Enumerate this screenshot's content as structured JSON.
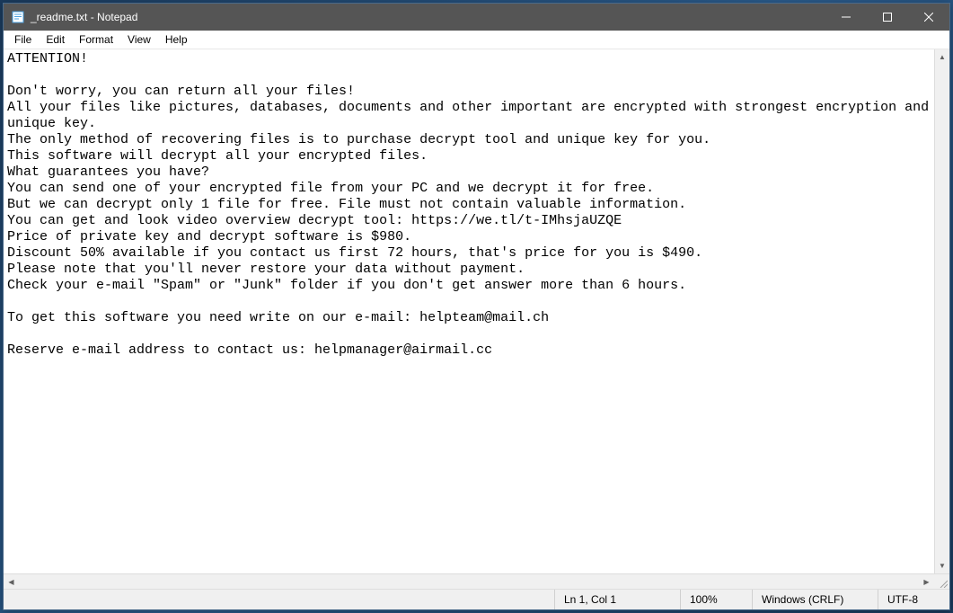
{
  "window": {
    "title": "_readme.txt - Notepad"
  },
  "menu": {
    "file": "File",
    "edit": "Edit",
    "format": "Format",
    "view": "View",
    "help": "Help"
  },
  "document": {
    "lines": [
      "ATTENTION!",
      "",
      "Don't worry, you can return all your files!",
      "All your files like pictures, databases, documents and other important are encrypted with strongest encryption and unique key.",
      "The only method of recovering files is to purchase decrypt tool and unique key for you.",
      "This software will decrypt all your encrypted files.",
      "What guarantees you have?",
      "You can send one of your encrypted file from your PC and we decrypt it for free.",
      "But we can decrypt only 1 file for free. File must not contain valuable information.",
      "You can get and look video overview decrypt tool: https://we.tl/t-IMhsjaUZQE",
      "Price of private key and decrypt software is $980.",
      "Discount 50% available if you contact us first 72 hours, that's price for you is $490.",
      "Please note that you'll never restore your data without payment.",
      "Check your e-mail \"Spam\" or \"Junk\" folder if you don't get answer more than 6 hours.",
      "",
      "To get this software you need write on our e-mail: helpteam@mail.ch",
      "",
      "Reserve e-mail address to contact us: helpmanager@airmail.cc"
    ]
  },
  "status": {
    "position": "Ln 1, Col 1",
    "zoom": "100%",
    "line_ending": "Windows (CRLF)",
    "encoding": "UTF-8"
  }
}
